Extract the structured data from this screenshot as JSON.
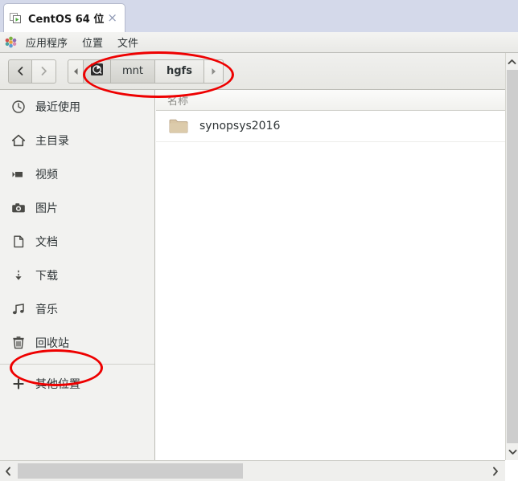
{
  "vm": {
    "tab_title": "CentOS 64 位",
    "tab_icon": "virtual-machine-icon",
    "close_label": "×",
    "chrome_color": "#d4d9ea"
  },
  "panel": {
    "logo_icon": "gnome-applications-icon",
    "items": [
      {
        "label": "应用程序",
        "name": "panel-menu-applications"
      },
      {
        "label": "位置",
        "name": "panel-menu-places"
      },
      {
        "label": "文件",
        "name": "panel-menu-files"
      }
    ]
  },
  "toolbar": {
    "back_icon": "chevron-left-icon",
    "back_glyph": "‹",
    "forward_icon": "chevron-right-icon",
    "forward_glyph": "›",
    "scroll_left_glyph": "◂",
    "scroll_right_glyph": "▸"
  },
  "breadcrumb": {
    "device_icon": "drive-icon",
    "crumbs": [
      {
        "label": "mnt",
        "current": false
      },
      {
        "label": "hgfs",
        "current": true
      }
    ]
  },
  "sidebar": {
    "items": [
      {
        "label": "最近使用",
        "icon": "clock-icon"
      },
      {
        "label": "主目录",
        "icon": "home-icon"
      },
      {
        "label": "视频",
        "icon": "video-camera-icon"
      },
      {
        "label": "图片",
        "icon": "camera-icon"
      },
      {
        "label": "文档",
        "icon": "document-icon"
      },
      {
        "label": "下载",
        "icon": "download-arrow-icon"
      },
      {
        "label": "音乐",
        "icon": "music-note-icon"
      },
      {
        "label": "回收站",
        "icon": "trash-icon"
      }
    ],
    "other_locations": {
      "label": "其他位置",
      "icon": "plus-icon"
    }
  },
  "fileview": {
    "columns": [
      "名称"
    ],
    "rows": [
      {
        "name": "synopsys2016",
        "icon": "folder-icon"
      }
    ]
  },
  "scrollbars": {
    "v_up_glyph": "⌃",
    "v_down_glyph": "⌄",
    "h_left_glyph": "‹",
    "h_right_glyph": "›"
  },
  "annotations": {
    "color": "#ee0000",
    "shapes": [
      {
        "name": "annotation-ellipse-breadcrumb",
        "target": "breadcrumb-path"
      },
      {
        "name": "annotation-ellipse-other-locations",
        "target": "sidebar-other-locations"
      }
    ]
  }
}
